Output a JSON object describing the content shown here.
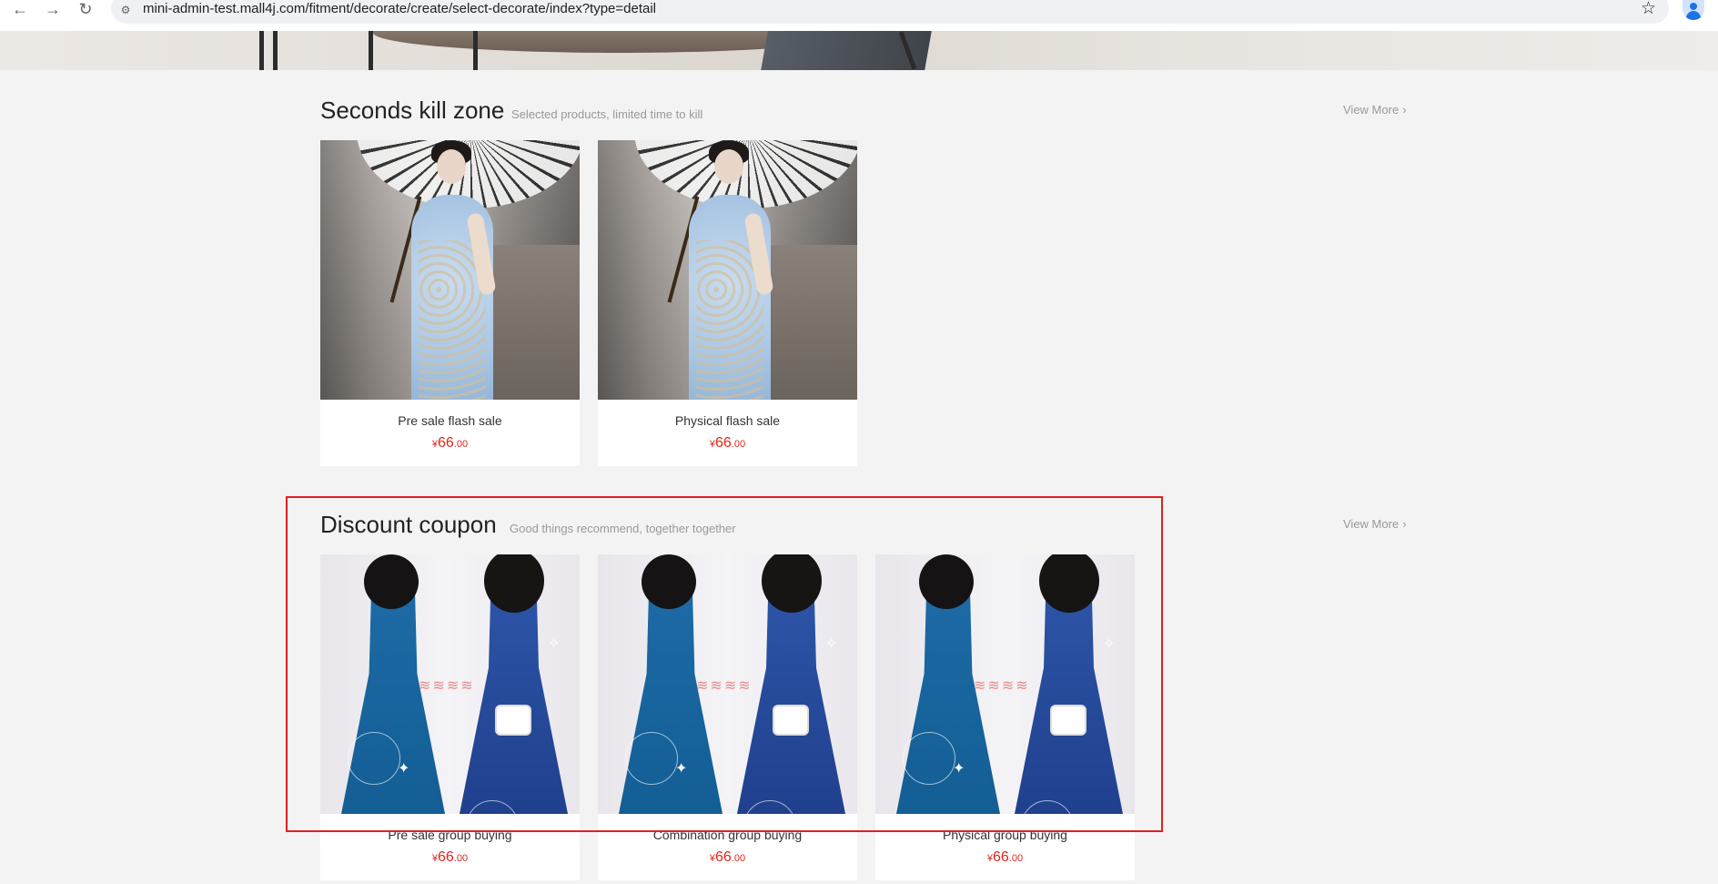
{
  "browser": {
    "url": "mini-admin-test.mall4j.com/fitment/decorate/create/select-decorate/index?type=detail",
    "back_icon": "←",
    "forward_icon": "→",
    "reload_icon": "↻",
    "star_icon": "☆",
    "site_info_icon": "⚙"
  },
  "sections": [
    {
      "title": "Seconds kill zone",
      "subtitle": "Selected products, limited time to kill",
      "view_more": "View More",
      "chevron": "›",
      "products": [
        {
          "name": "Pre sale flash sale",
          "currency": "¥",
          "price_int": "66",
          "price_dec": ".00"
        },
        {
          "name": "Physical flash sale",
          "currency": "¥",
          "price_int": "66",
          "price_dec": ".00"
        }
      ]
    },
    {
      "title": "Discount coupon",
      "subtitle": "Good things recommend, together together",
      "view_more": "View More",
      "chevron": "›",
      "products": [
        {
          "name": "Pre sale group buying",
          "currency": "¥",
          "price_int": "66",
          "price_dec": ".00"
        },
        {
          "name": "Combination group buying",
          "currency": "¥",
          "price_int": "66",
          "price_dec": ".00"
        },
        {
          "name": "Physical group buying",
          "currency": "¥",
          "price_int": "66",
          "price_dec": ".00"
        }
      ]
    }
  ],
  "colors": {
    "price": "#e1251b",
    "selection_outline": "#e02020",
    "page_background": "#f3f3f3"
  }
}
